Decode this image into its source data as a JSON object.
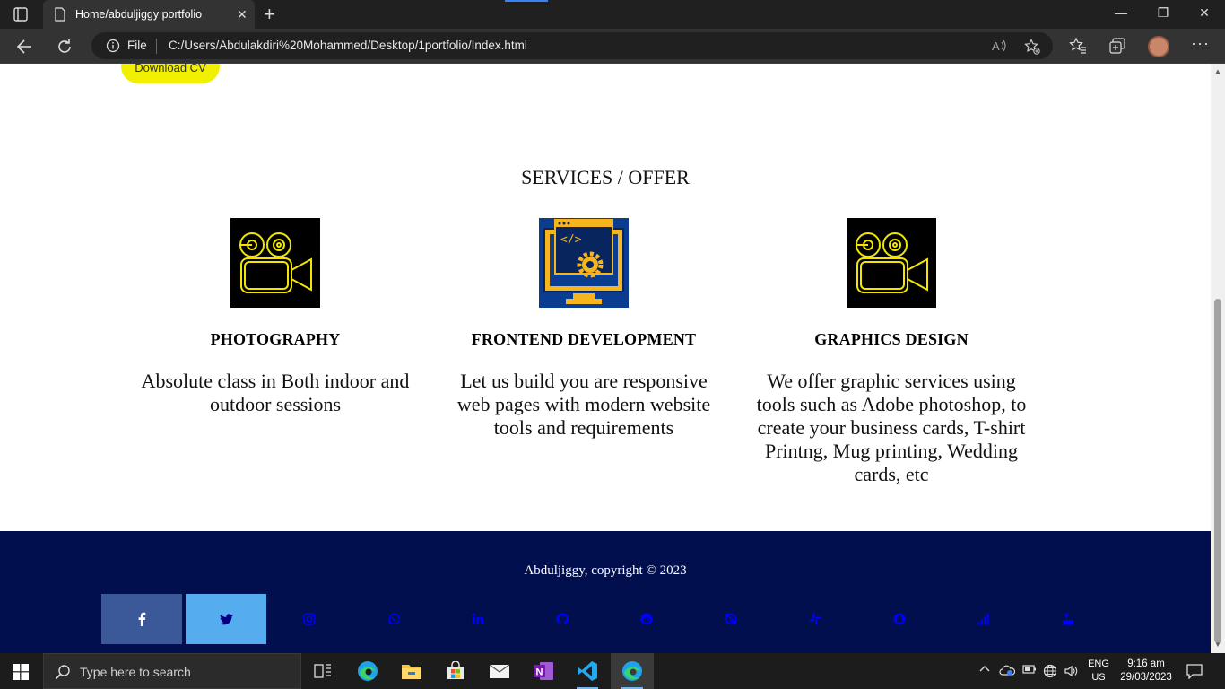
{
  "browser": {
    "tab_title": "Home/abduljiggy portfolio",
    "address_scheme": "File",
    "url": "C:/Users/Abdulakdiri%20Mohammed/Desktop/1portfolio/Index.html"
  },
  "page": {
    "download_cv": "Download CV",
    "services_title": "SERVICES / OFFER",
    "services": [
      {
        "icon": "video-camera-icon",
        "title": "PHOTOGRAPHY",
        "description": "Absolute class in Both indoor and outdoor sessions"
      },
      {
        "icon": "monitor-code-gear-icon",
        "title": "FRONTEND DEVELOPMENT",
        "description": "Let us build you are responsive web pages with modern website tools and requirements"
      },
      {
        "icon": "video-camera-icon",
        "title": "GRAPHICS DESIGN",
        "description": "We offer graphic services using tools such as Adobe photoshop, to create your business cards, T-shirt Printng, Mug printing, Wedding cards, etc"
      }
    ],
    "footer": {
      "copyright": "Abduljiggy, copyright © 2023",
      "social": [
        "facebook",
        "twitter",
        "instagram",
        "whatsapp",
        "linkedin",
        "github",
        "reddit",
        "skype",
        "slack",
        "snapchat",
        "signal",
        "youtube"
      ]
    }
  },
  "taskbar": {
    "search_placeholder": "Type here to search",
    "lang_top": "ENG",
    "lang_bottom": "US",
    "time": "9:16 am",
    "date": "29/03/2023"
  },
  "colors": {
    "footer_bg": "#020f4f",
    "cv_button": "#f0f000",
    "facebook": "#3b5998",
    "twitter": "#55acee",
    "social_icon": "#0000ff"
  }
}
